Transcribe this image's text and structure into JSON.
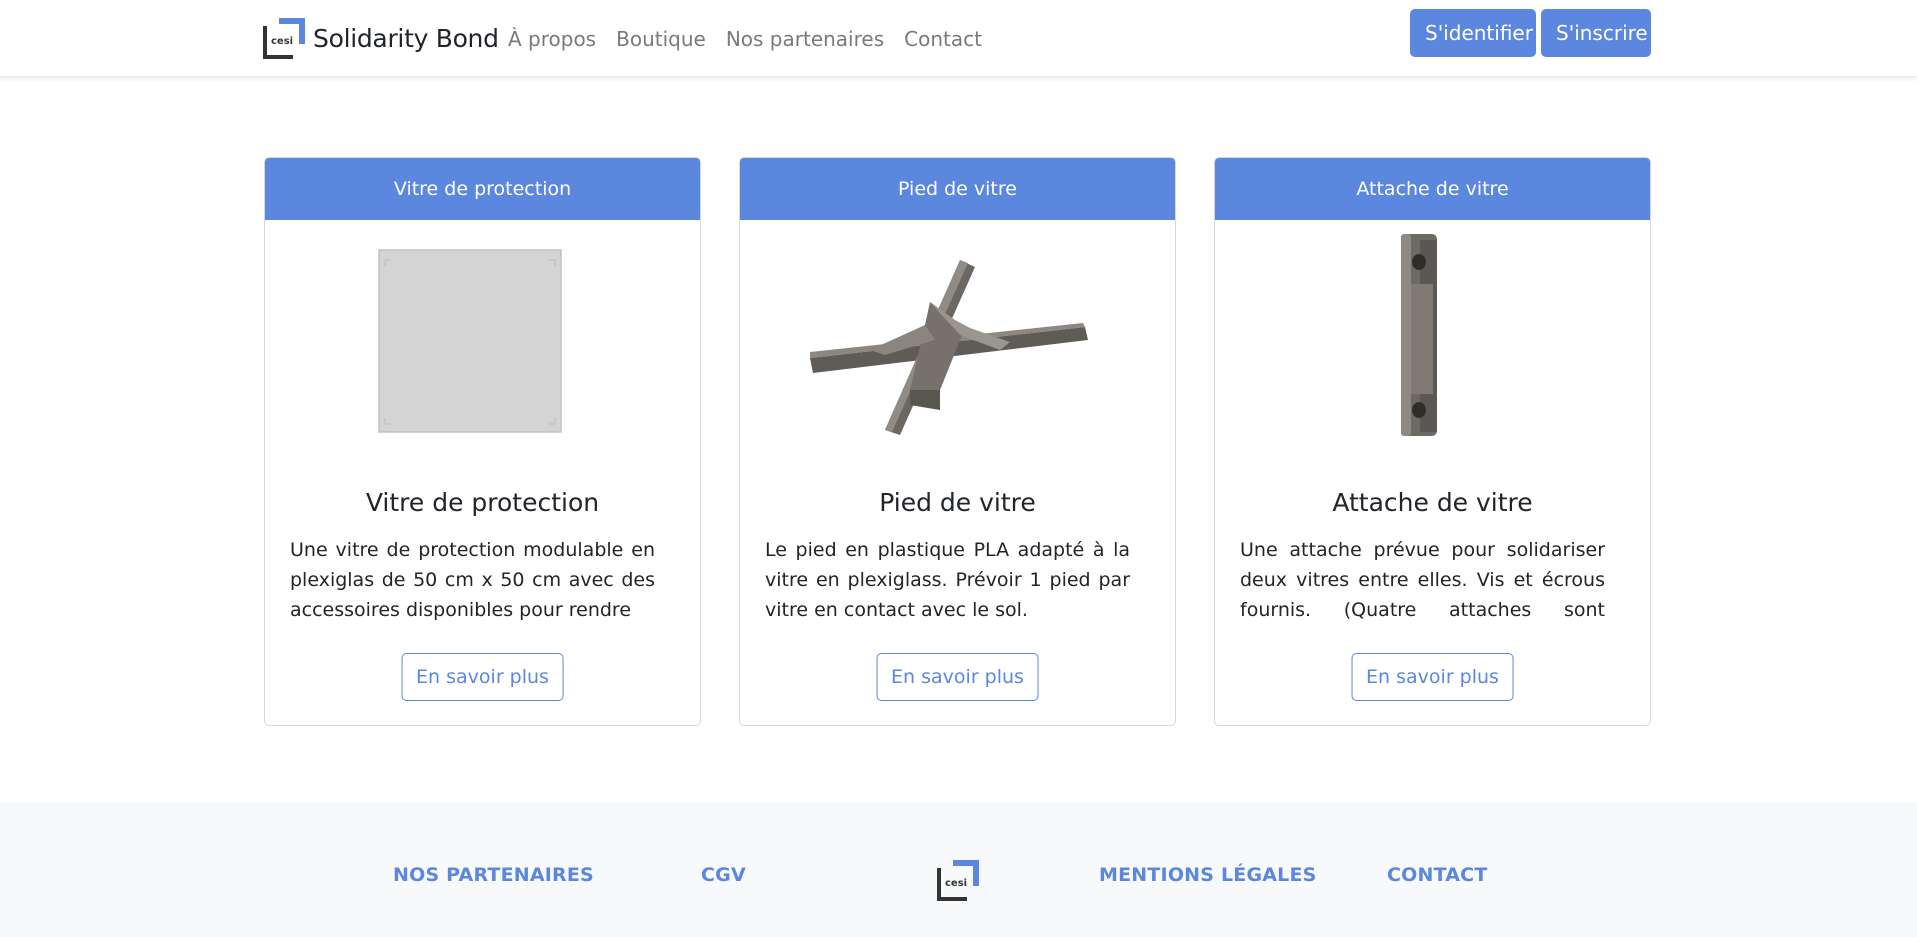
{
  "navbar": {
    "brand_logo_text": "cesi",
    "brand": "Solidarity Bond",
    "links": [
      {
        "label": "À propos"
      },
      {
        "label": "Boutique"
      },
      {
        "label": "Nos partenaires"
      },
      {
        "label": "Contact"
      }
    ],
    "login_label": "S'identifier",
    "signup_label": "S'inscrire"
  },
  "products": [
    {
      "header": "Vitre de protection",
      "title": "Vitre de protection",
      "description": "Une vitre de protection modulable en plexiglas de 50 cm x 50 cm avec des accessoires disponibles pour rendre",
      "button": "En savoir plus",
      "image_icon": "glass-panel-image"
    },
    {
      "header": "Pied de vitre",
      "title": "Pied de vitre",
      "description": "Le pied en plastique PLA adapté à la vitre en plexiglass. Prévoir 1 pied par vitre en contact avec le sol.",
      "button": "En savoir plus",
      "image_icon": "glass-stand-image"
    },
    {
      "header": "Attache de vitre",
      "title": "Attache de vitre",
      "description": "Une attache prévue pour solidariser deux vitres entre elles. Vis et écrous fournis. (Quatre attaches sont nécessaires pour",
      "button": "En savoir plus",
      "image_icon": "glass-clip-image"
    }
  ],
  "footer": {
    "partners": "NOS PARTENAIRES",
    "cgv": "CGV",
    "logo_text": "cesi",
    "legal": "MENTIONS LÉGALES",
    "contact": "CONTACT"
  },
  "colors": {
    "primary": "#5b87df",
    "footer_bg": "#f8f9fa"
  }
}
